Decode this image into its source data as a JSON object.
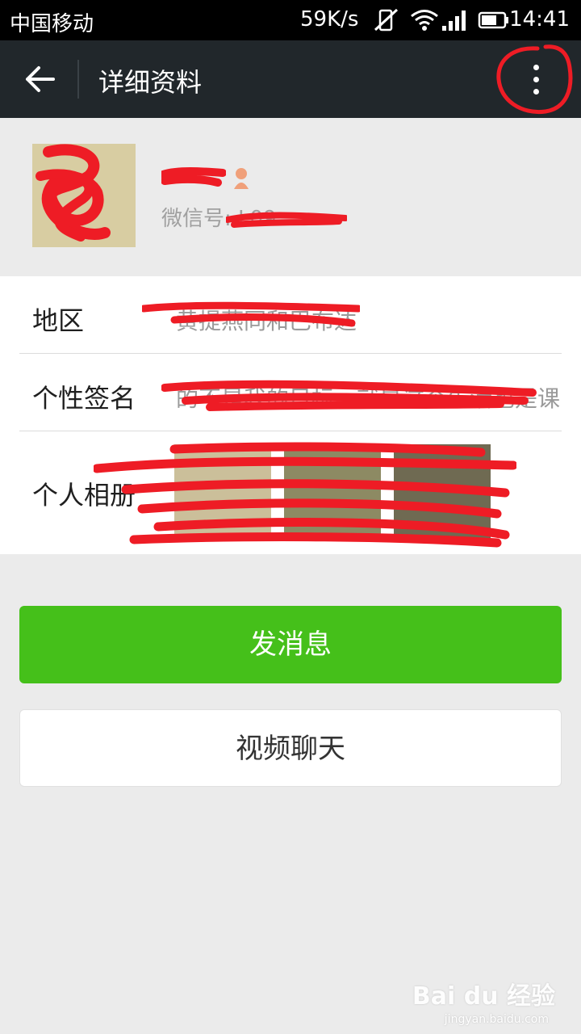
{
  "status_bar": {
    "carrier": "中国移动",
    "net_speed": "59K/s",
    "time": "14:41"
  },
  "title_bar": {
    "back_icon": "arrow-left-icon",
    "title": "详细资料",
    "more_icon": "more-vertical-icon"
  },
  "profile": {
    "name": "",
    "wechat_id_label": "微信号: L09",
    "gender_icon": "female-gender-icon"
  },
  "info": {
    "region_label": "地区",
    "region_value": "黄提燕同和巴布达",
    "signature_label": "个性签名",
    "signature_value": "的不是我的目标一就是这个生活也是课",
    "album_label": "个人相册"
  },
  "actions": {
    "send_message": "发消息",
    "video_chat": "视频聊天"
  },
  "watermark": {
    "brand": "Bai du 经验",
    "url": "jingyan.baidu.com"
  },
  "colors": {
    "accent_green": "#45c01a",
    "titlebar": "#21272b",
    "annotation_red": "#ee1c25"
  }
}
